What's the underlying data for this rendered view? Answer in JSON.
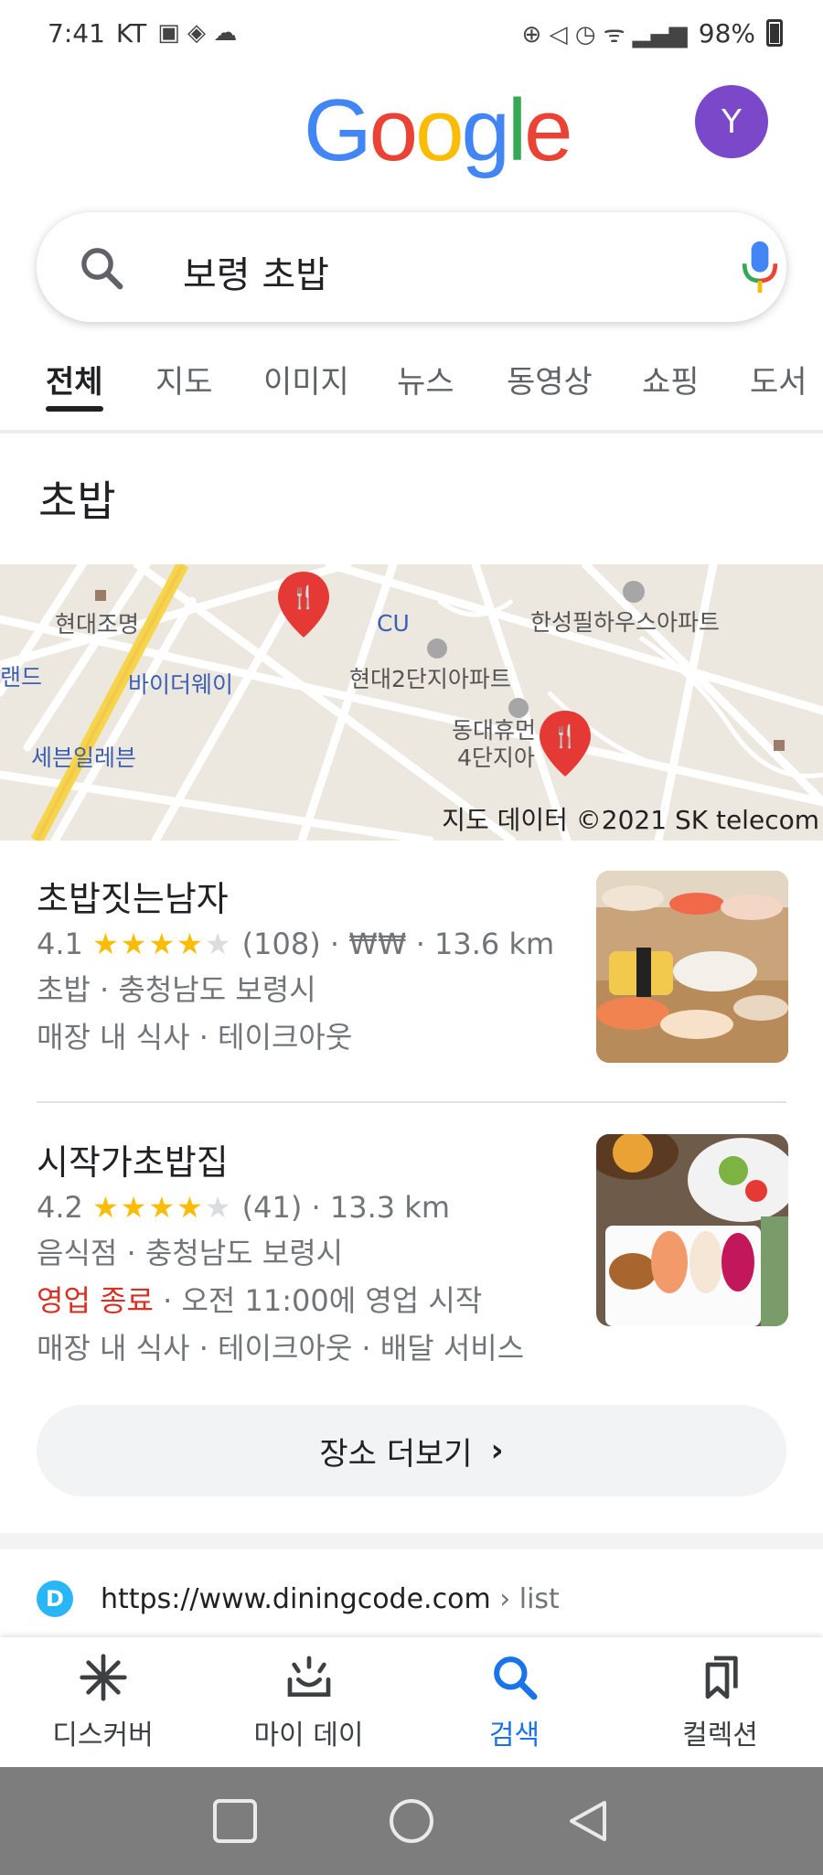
{
  "status_bar": {
    "time": "7:41",
    "carrier": "KT",
    "battery": "98%"
  },
  "header": {
    "logo_letters": [
      "G",
      "o",
      "o",
      "g",
      "l",
      "e"
    ],
    "logo_colors": [
      "#4285F4",
      "#EA4335",
      "#FBBC05",
      "#4285F4",
      "#34A853",
      "#EA4335"
    ],
    "avatar_letter": "Y"
  },
  "search": {
    "query": "보령 초밥"
  },
  "tabs": [
    {
      "label": "전체",
      "active": true
    },
    {
      "label": "지도"
    },
    {
      "label": "이미지"
    },
    {
      "label": "뉴스"
    },
    {
      "label": "동영상"
    },
    {
      "label": "쇼핑"
    },
    {
      "label": "도서"
    }
  ],
  "section": {
    "title": "초밥"
  },
  "map": {
    "labels": [
      "현대조명",
      "CU",
      "한성필하우스아파트",
      "바이더웨이",
      "현대2단지아파트",
      "랜드",
      "세븐일레븐",
      "동대휴먼",
      "4단지아"
    ],
    "copyright": "지도 데이터 ©2021 SK telecom"
  },
  "results": [
    {
      "name": "초밥짓는남자",
      "rating": "4.1",
      "rating_value": 4.1,
      "reviews": "(108)",
      "price": "₩₩",
      "distance": "13.6 km",
      "category_line": "초밥 · 충청남도 보령시",
      "services_line": "매장 내 식사 · 테이크아웃"
    },
    {
      "name": "시작가초밥집",
      "rating": "4.2",
      "rating_value": 4.2,
      "reviews": "(41)",
      "distance": "13.3 km",
      "category_line": "음식점 · 충청남도 보령시",
      "status": "영업 종료",
      "hours": "오전 11:00에 영업 시작",
      "services_line": "매장 내 식사 · 테이크아웃 · 배달 서비스"
    }
  ],
  "more_places": {
    "label": "장소 더보기"
  },
  "web_result": {
    "url": "https://www.diningcode.com",
    "path": "› list"
  },
  "bottom_nav": [
    {
      "label": "디스커버",
      "icon": "asterisk-icon"
    },
    {
      "label": "마이 데이",
      "icon": "sunrise-icon"
    },
    {
      "label": "검색",
      "icon": "search-icon",
      "active": true
    },
    {
      "label": "컬렉션",
      "icon": "bookmarks-icon"
    }
  ],
  "colors": {
    "accent": "#1a73e8",
    "star": "#fbbc04",
    "closed": "#d93025",
    "map_pin": "#e53935"
  }
}
